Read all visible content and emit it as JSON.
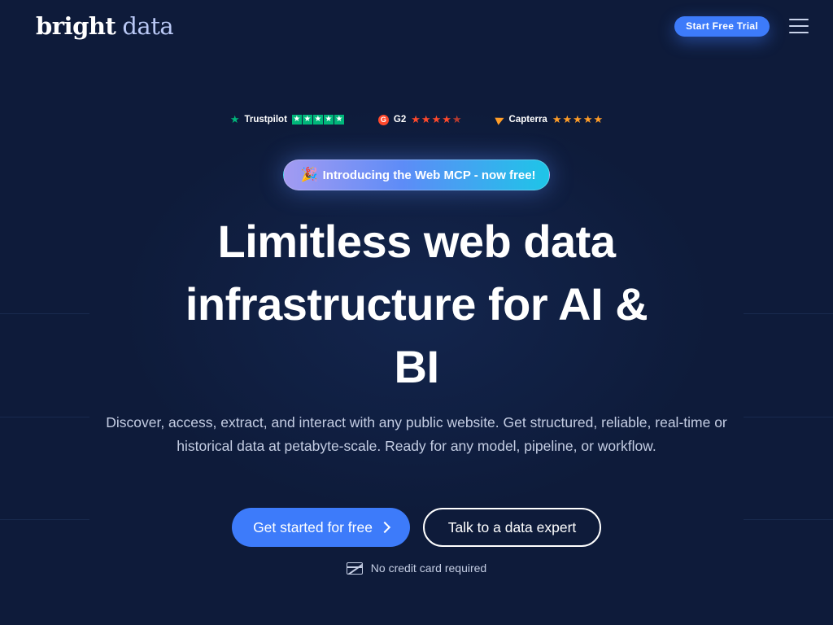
{
  "header": {
    "logo_part1": "bright",
    "logo_part2": "data",
    "trial_button": "Start Free Trial",
    "menu_icon": "hamburger-menu-icon"
  },
  "ratings": [
    {
      "name": "Trustpilot",
      "stars": 5,
      "color": "#00b67a"
    },
    {
      "name": "G2",
      "stars": 4.5,
      "color": "#ff492c"
    },
    {
      "name": "Capterra",
      "stars": 5,
      "color": "#ff9d28"
    }
  ],
  "announcement": {
    "icon": "party-popper-icon",
    "text": "Introducing the Web MCP - now free!"
  },
  "hero": {
    "headline_line1": "Limitless web data",
    "headline_line2": "infrastructure for AI &",
    "headline_line3": "BI",
    "subtext_line1": "Discover, access, extract, and interact with any public website. Get structured, reliable, real-time or",
    "subtext_line2": "historical data at petabyte-scale. Ready for any model, pipeline, or workflow."
  },
  "cta": {
    "primary": "Get started for free",
    "secondary": "Talk to a data expert"
  },
  "note": {
    "icon": "credit-card-off-icon",
    "text": "No credit card required"
  },
  "colors": {
    "background": "#0e1b3a",
    "accent": "#3d7bfa"
  }
}
